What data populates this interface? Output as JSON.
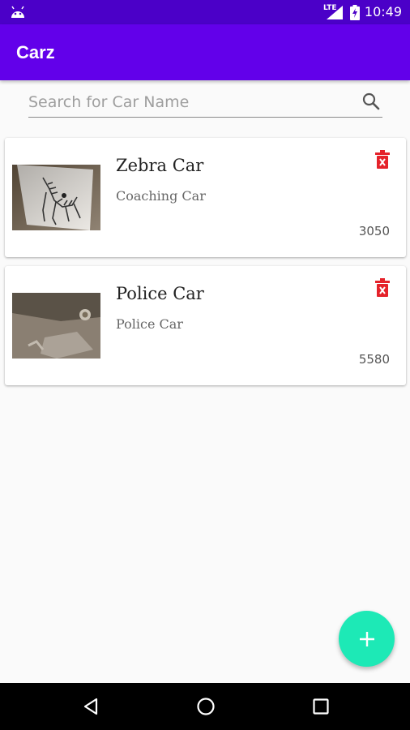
{
  "status_bar": {
    "time": "10:49",
    "network": "LTE",
    "icons": [
      "android-icon",
      "lte-signal-icon",
      "battery-charging-icon"
    ]
  },
  "app_bar": {
    "title": "Carz",
    "color": "#6200ea"
  },
  "search": {
    "placeholder": "Search for Car Name",
    "value": "",
    "icon": "search-icon"
  },
  "cars": [
    {
      "name": "Zebra Car",
      "description": "Coaching Car",
      "price": "3050",
      "thumbnail": "zebra-drawing-photo",
      "delete_icon": "delete-icon"
    },
    {
      "name": "Police Car",
      "description": "Police Car",
      "price": "5580",
      "thumbnail": "room-floor-photo",
      "delete_icon": "delete-icon"
    }
  ],
  "fab": {
    "icon": "plus-icon",
    "color": "#1de9b6"
  },
  "nav_bar": {
    "buttons": [
      "back-icon",
      "home-icon",
      "recents-icon"
    ]
  },
  "colors": {
    "status_bar": "#4b00c8",
    "delete": "#e5222a"
  }
}
